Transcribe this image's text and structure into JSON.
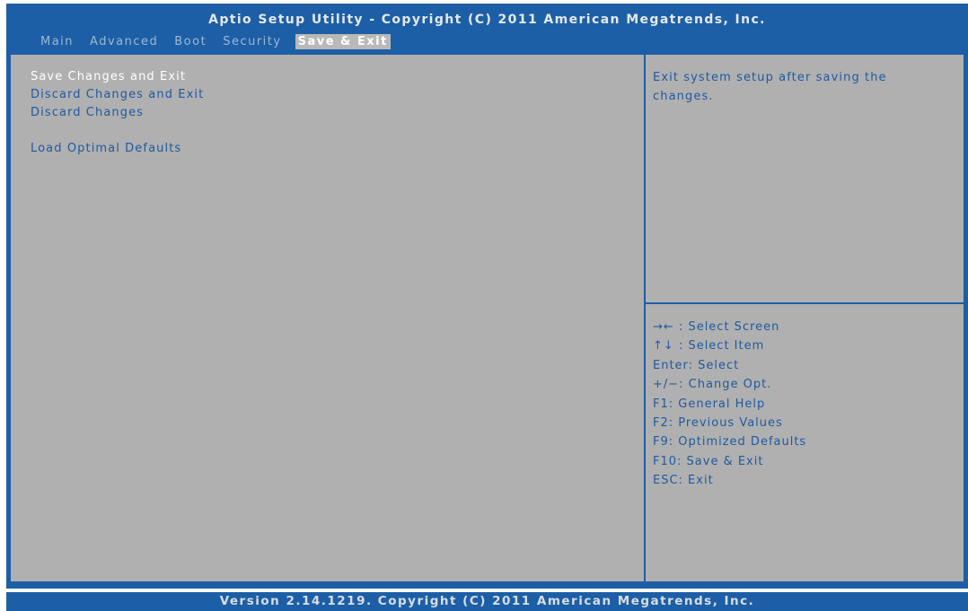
{
  "header": {
    "title": "Aptio Setup Utility - Copyright (C) 2011 American Megatrends, Inc."
  },
  "tabs": [
    {
      "label": "Main",
      "active": false
    },
    {
      "label": "Advanced",
      "active": false
    },
    {
      "label": "Boot",
      "active": false
    },
    {
      "label": "Security",
      "active": false
    },
    {
      "label": "Save & Exit",
      "active": true
    }
  ],
  "menu": {
    "items": [
      {
        "label": "Save Changes and Exit",
        "selected": true
      },
      {
        "label": "Discard Changes and Exit",
        "selected": false
      },
      {
        "label": "Discard Changes",
        "selected": false
      },
      {
        "label": "Load Optimal Defaults",
        "selected": false
      }
    ]
  },
  "help": {
    "text": "Exit system setup after saving the changes."
  },
  "keys": [
    {
      "icon": "left-right-arrows-icon",
      "glyph": "→←",
      "text": ": Select Screen"
    },
    {
      "icon": "up-down-arrows-icon",
      "glyph": "↑↓",
      "text": ": Select Item"
    },
    {
      "icon": "",
      "glyph": "",
      "text": "Enter: Select"
    },
    {
      "icon": "",
      "glyph": "",
      "text": "+/−: Change Opt."
    },
    {
      "icon": "",
      "glyph": "",
      "text": "F1: General Help"
    },
    {
      "icon": "",
      "glyph": "",
      "text": "F2: Previous Values"
    },
    {
      "icon": "",
      "glyph": "",
      "text": "F9: Optimized Defaults"
    },
    {
      "icon": "",
      "glyph": "",
      "text": "F10: Save & Exit"
    },
    {
      "icon": "",
      "glyph": "",
      "text": "ESC: Exit"
    }
  ],
  "footer": {
    "text": "Version 2.14.1219. Copyright (C) 2011 American Megatrends, Inc."
  },
  "colors": {
    "bios_blue": "#1d5fa6",
    "panel_gray": "#b0b0b0",
    "text_blue": "#1f5aa0",
    "highlight_white": "#ffffff"
  }
}
